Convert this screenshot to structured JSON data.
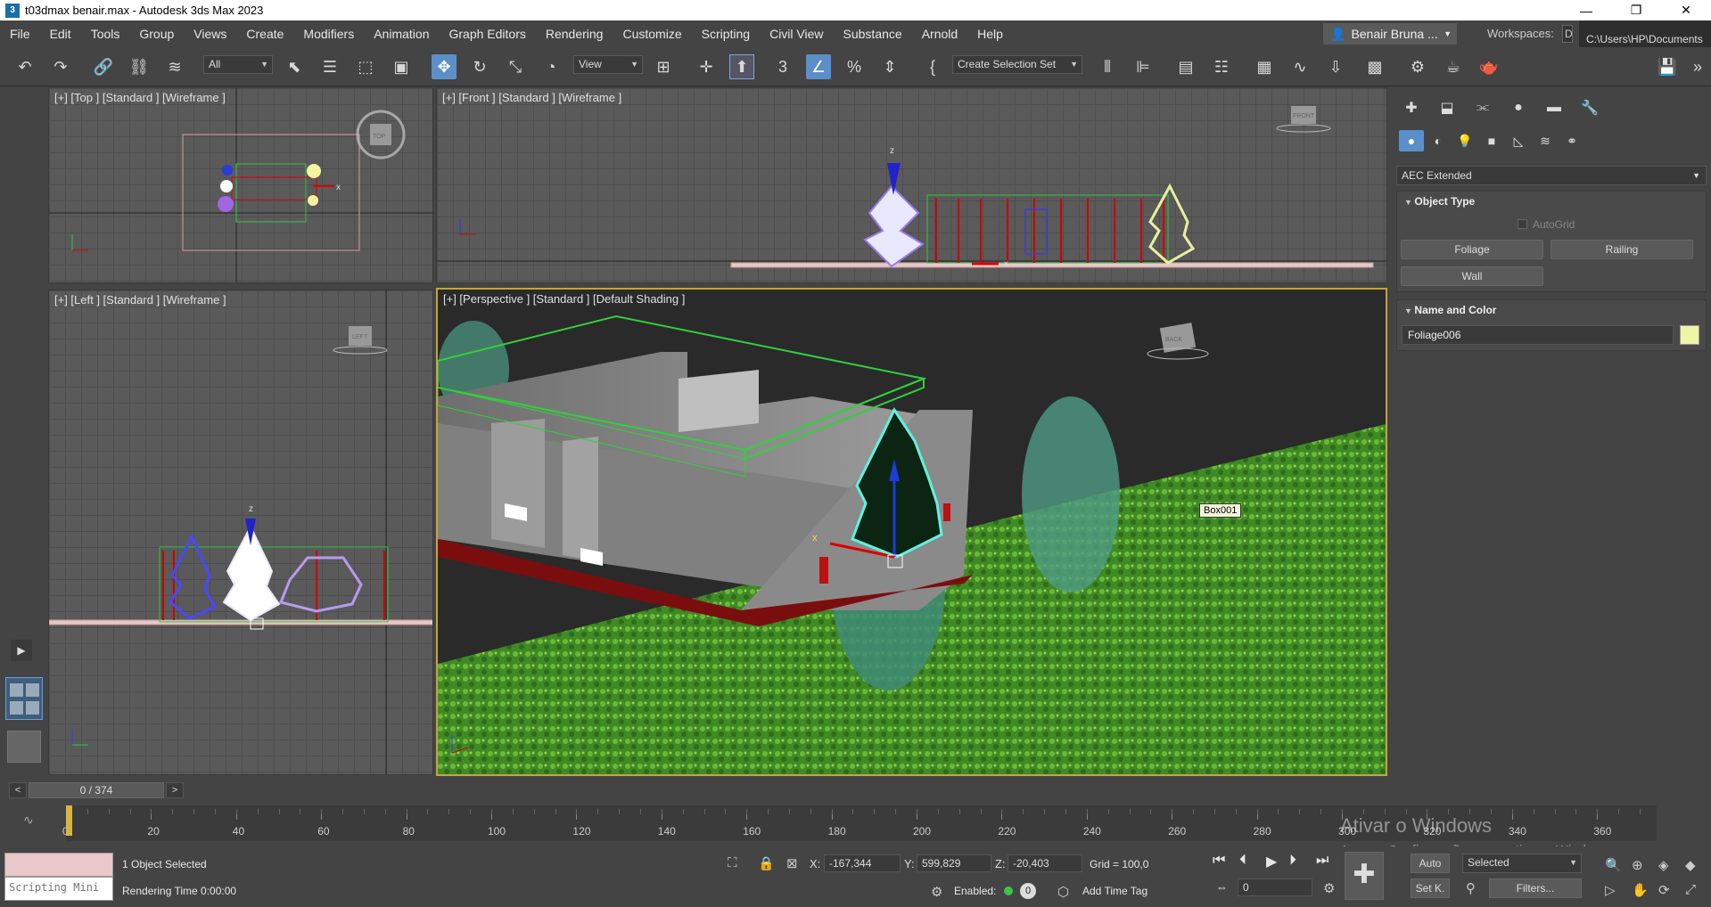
{
  "window": {
    "title": "t03dmax benair.max - Autodesk 3ds Max 2023",
    "app_icon": "3"
  },
  "menu": [
    "File",
    "Edit",
    "Tools",
    "Group",
    "Views",
    "Create",
    "Modifiers",
    "Animation",
    "Graph Editors",
    "Rendering",
    "Customize",
    "Scripting",
    "Civil View",
    "Substance",
    "Arnold",
    "Help"
  ],
  "user": {
    "name": "Benair Bruna ..."
  },
  "workspaces": {
    "label": "Workspaces:",
    "value": "D"
  },
  "project_path": "C:\\Users\\HP\\Documents",
  "toolbar": {
    "selection_filter": "All",
    "ref_coord": "View",
    "selection_set": "Create Selection Set"
  },
  "viewports": {
    "top": "[+] [Top ] [Standard ] [Wireframe ]",
    "front": "[+] [Front ] [Standard ] [Wireframe ]",
    "left": "[+] [Left ] [Standard ] [Wireframe ]",
    "perspective": "[+] [Perspective ] [Standard ] [Default Shading ]"
  },
  "viewcube": {
    "top": "TOP",
    "front": "FRONT",
    "left": "LEFT",
    "persp": "BACK"
  },
  "scene_tooltip": "Box001",
  "axis": {
    "x": "x",
    "z": "z",
    "y": "y"
  },
  "command_panel": {
    "category": "AEC Extended",
    "object_type": {
      "title": "Object Type",
      "autogrid": "AutoGrid",
      "buttons": [
        "Foliage",
        "Railing",
        "Wall"
      ]
    },
    "name_color": {
      "title": "Name and Color",
      "name": "Foliage006",
      "color": "#f0f5a5"
    }
  },
  "time_slider": {
    "value": "0 / 374",
    "prev": "<",
    "next": ">"
  },
  "track_ticks": [
    "0",
    "20",
    "40",
    "60",
    "80",
    "100",
    "120",
    "140",
    "160",
    "180",
    "200",
    "220",
    "240",
    "260",
    "280",
    "300",
    "320",
    "340",
    "360"
  ],
  "status": {
    "selection": "1 Object Selected",
    "rendering_time": "Rendering Time  0:00:00",
    "script_label": "Scripting Mini",
    "x_label": "X:",
    "x": "-167,344",
    "y_label": "Y:",
    "y": "599,829",
    "z_label": "Z:",
    "z": "-20,403",
    "grid": "Grid = 100,0",
    "enabled": "Enabled:",
    "enabled_value": "0",
    "add_time_tag": "Add Time Tag",
    "auto": "Auto",
    "selected": "Selected",
    "setkey": "Set K.",
    "filters": "Filters...",
    "frame": "0"
  },
  "watermark": {
    "line1": "Ativar o Windows",
    "line2": "Acesse Configurações para ativar o Windows."
  }
}
